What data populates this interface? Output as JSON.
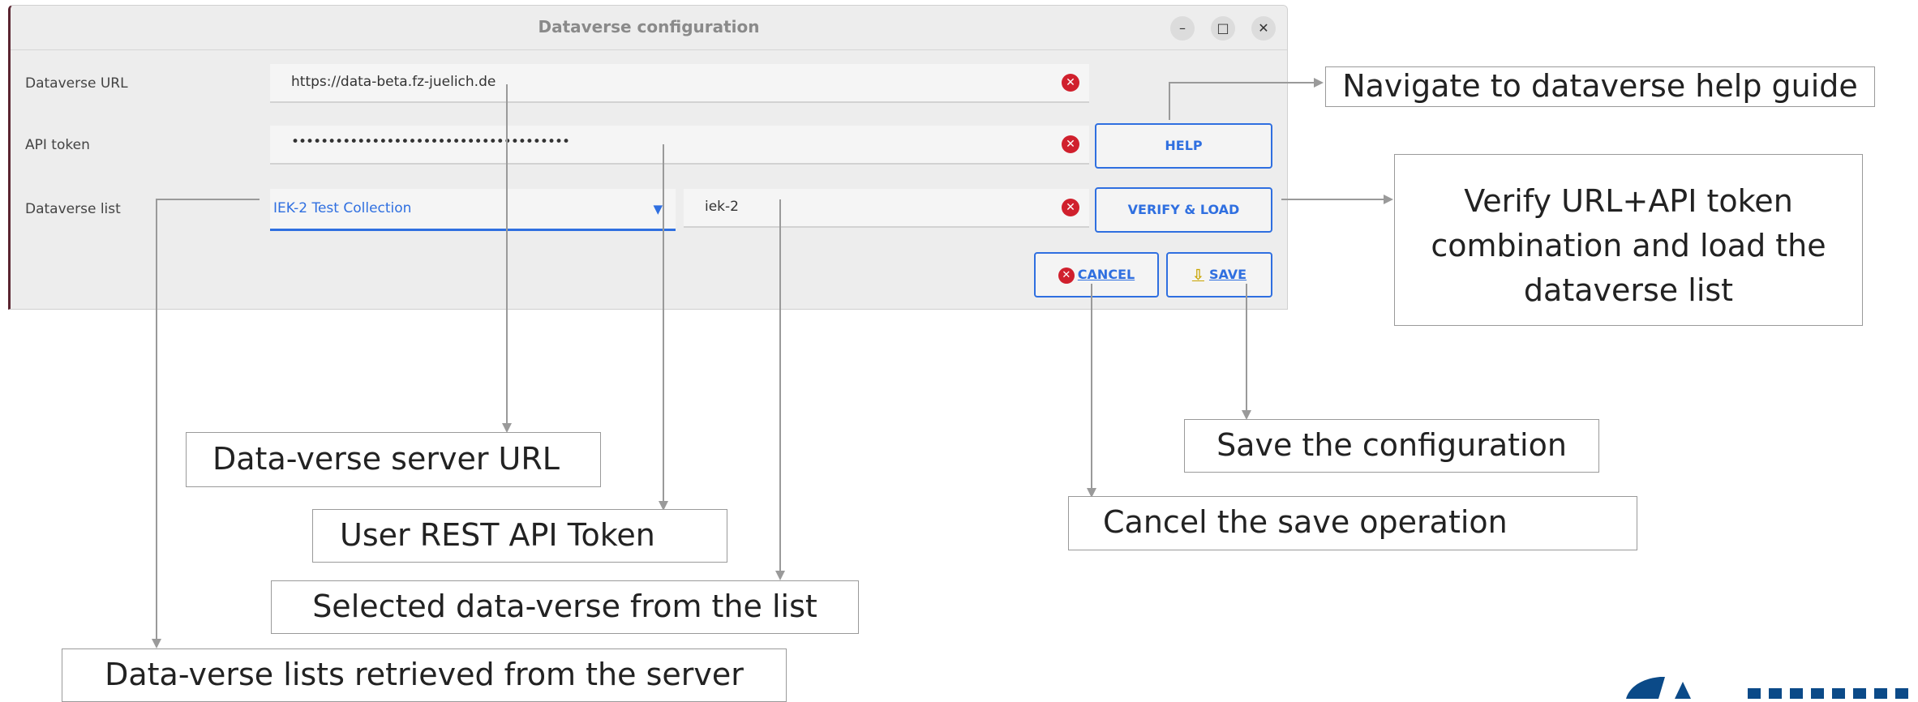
{
  "window": {
    "title": "Dataverse configuration",
    "controls": {
      "minimize": "–",
      "maximize": "□",
      "close": "✕"
    }
  },
  "form": {
    "url_label": "Dataverse URL",
    "url_value": "https://data-beta.fz-juelich.de",
    "token_label": "API token",
    "token_value": "••••••••••••••••••••••••••••••••••••••",
    "list_label": "Dataverse list",
    "list_selected": "IEK-2 Test Collection",
    "alias_value": "iek-2"
  },
  "buttons": {
    "help": "HELP",
    "verify": "VERIFY & LOAD",
    "cancel_mnemonic": "C",
    "cancel_rest": "ANCEL",
    "save_mnemonic": "S",
    "save_rest": "AVE"
  },
  "annotations": {
    "help": "Navigate to dataverse help guide",
    "verify": "Verify URL+API token combination and load the dataverse list",
    "url": "Data-verse server URL",
    "token": "User REST API Token",
    "selected": "Selected data-verse from the list",
    "lists": "Data-verse lists retrieved from the server",
    "save": "Save the configuration",
    "cancel": "Cancel the save operation"
  },
  "colors": {
    "accent": "#2f6fe0",
    "clear_icon": "#d0202d",
    "logo": "#0b4a88"
  }
}
